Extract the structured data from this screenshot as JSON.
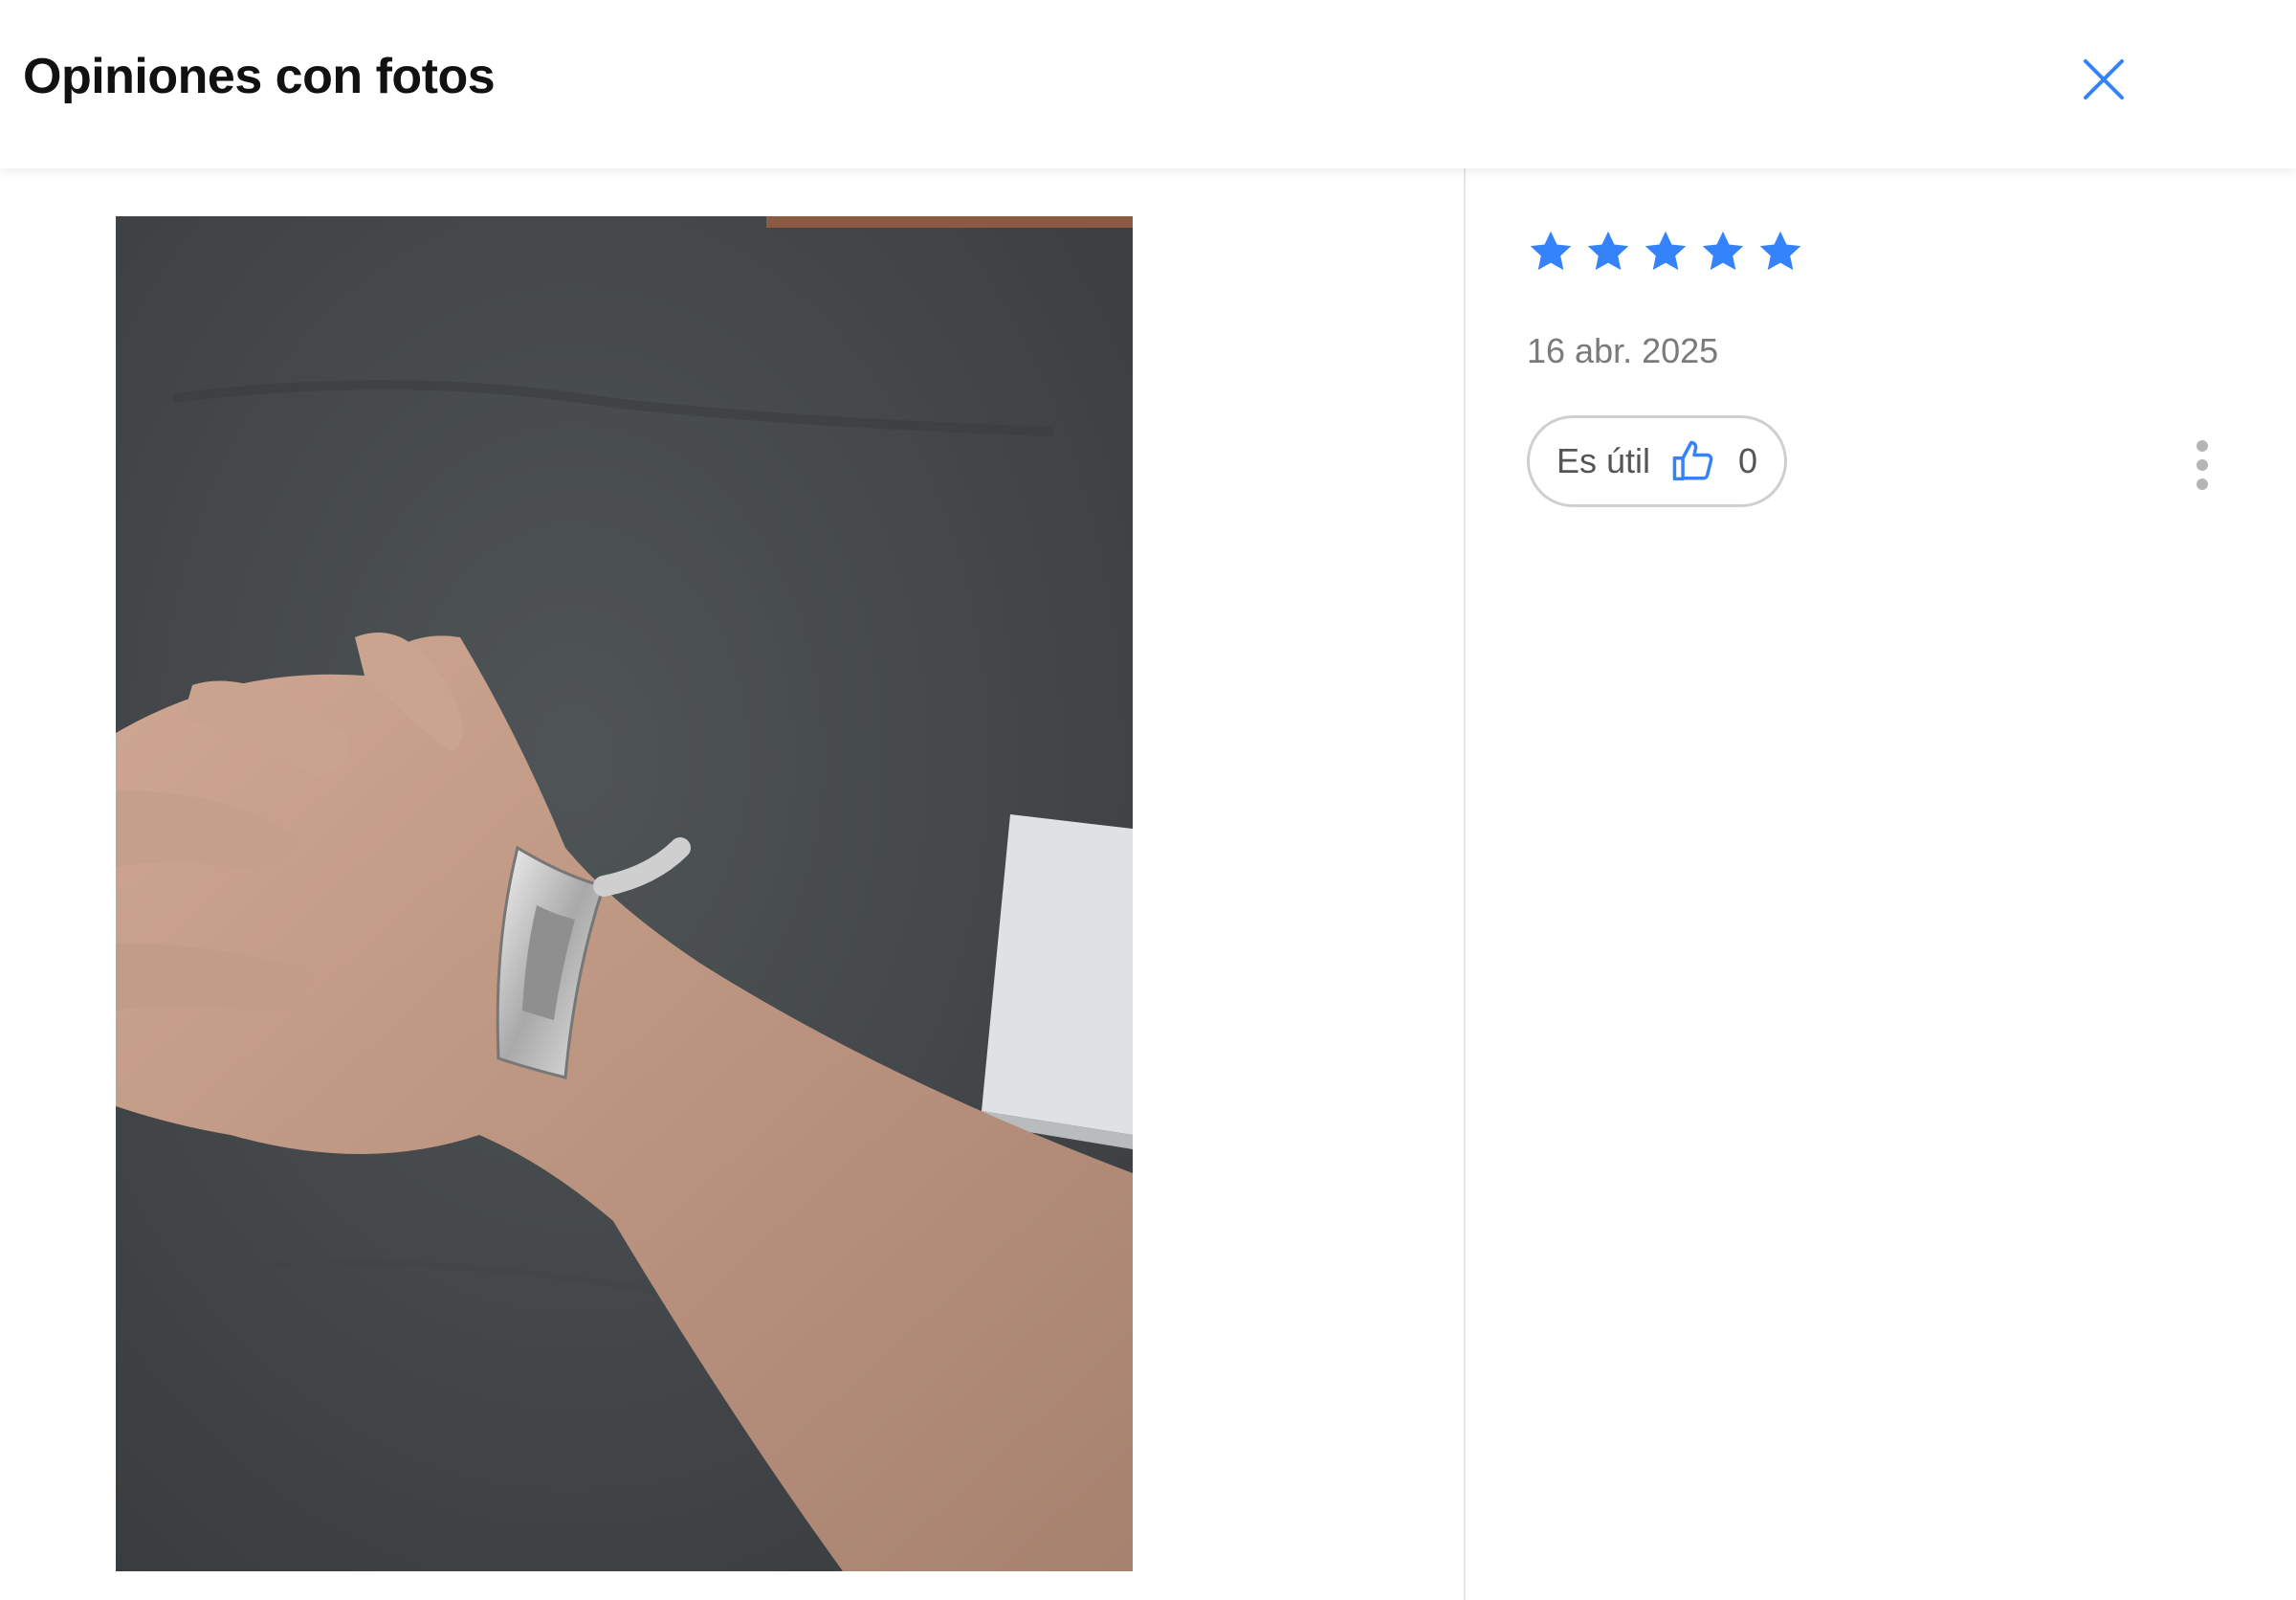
{
  "header": {
    "title": "Opiniones con fotos"
  },
  "review": {
    "rating": 5,
    "max_rating": 5,
    "date": "16 abr. 2025",
    "helpful_label": "Es útil",
    "helpful_count": "0"
  },
  "icons": {
    "close": "close-icon",
    "star": "star-icon",
    "thumb": "thumbs-up-icon",
    "more": "more-vertical-icon"
  },
  "colors": {
    "accent": "#3483fa",
    "text": "#111111",
    "muted": "#7a7a7a"
  }
}
